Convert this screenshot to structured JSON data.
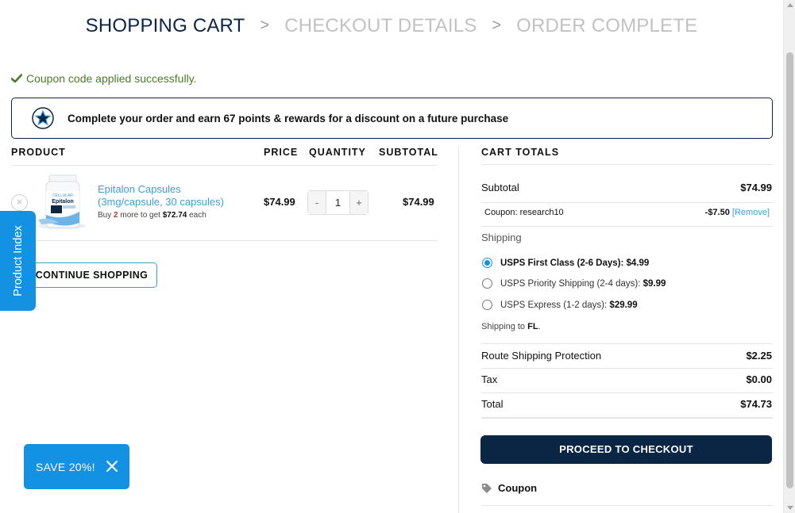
{
  "steps": {
    "step1": "SHOPPING CART",
    "step2": "CHECKOUT DETAILS",
    "step3": "ORDER COMPLETE",
    "separator": ">"
  },
  "notice": {
    "message": "Coupon code applied successfully.",
    "icon": "check-icon",
    "color": "#4b7a2a"
  },
  "rewards": {
    "icon": "star-badge-icon",
    "text": "Complete your order and earn 67 points & rewards for a discount on a future purchase"
  },
  "cart_table": {
    "headers": {
      "product": "PRODUCT",
      "price": "PRICE",
      "quantity": "QUANTITY",
      "subtotal": "SUBTOTAL"
    },
    "items": [
      {
        "name_line1": "Epitalon Capsules",
        "name_line2": "(3mg/capsule, 30 capsules)",
        "upsell_prefix": "Buy",
        "upsell_qty": "2",
        "upsell_mid": "more to get",
        "upsell_price": "$72.74",
        "upsell_suffix": "each",
        "price": "$74.99",
        "quantity": "1",
        "subtotal": "$74.99",
        "remove_symbol": "×",
        "qty_minus": "-",
        "qty_plus": "+"
      }
    ]
  },
  "continue_button": "CONTINUE SHOPPING",
  "product_index_tab": "Product Index",
  "cart_totals": {
    "title": "CART TOTALS",
    "subtotal_label": "Subtotal",
    "subtotal_value": "$74.99",
    "coupon_label": "Coupon: research10",
    "coupon_value": "-$7.50",
    "coupon_remove": "[Remove]",
    "shipping_label": "Shipping",
    "shipping_options": [
      {
        "label": "USPS First Class (2-6 Days):",
        "price": "$4.99",
        "selected": true
      },
      {
        "label": "USPS Priority Shipping (2-4 days):",
        "price": "$9.99",
        "selected": false
      },
      {
        "label": "USPS Express (1-2 days):",
        "price": "$29.99",
        "selected": false
      }
    ],
    "shipping_to_prefix": "Shipping to",
    "shipping_to_state": "FL",
    "shipping_to_suffix": ".",
    "route_label": "Route Shipping Protection",
    "route_value": "$2.25",
    "tax_label": "Tax",
    "tax_value": "$0.00",
    "total_label": "Total",
    "total_value": "$74.73"
  },
  "checkout_button": "PROCEED TO CHECKOUT",
  "coupon_toggle": {
    "label": "Coupon",
    "icon": "tag-icon"
  },
  "save_badge": {
    "label": "SAVE 20%!",
    "icon": "close-icon"
  },
  "colors": {
    "navy": "#0b2545",
    "accent_blue": "#1392e3",
    "link_blue": "#3aa0d8"
  }
}
